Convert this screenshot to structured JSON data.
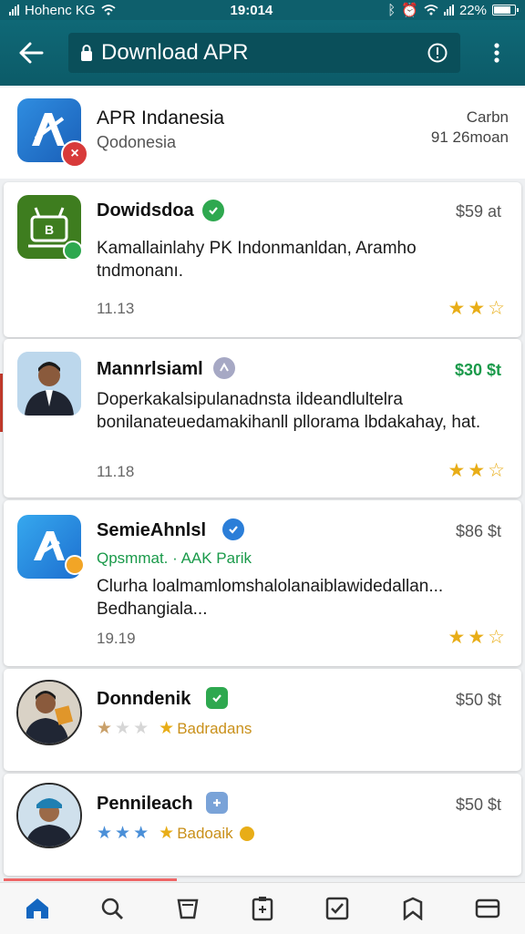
{
  "status_bar": {
    "carrier": "Hohenc KG",
    "time": "19:014",
    "battery": "22%"
  },
  "top_bar": {
    "search_value": "Download APR"
  },
  "header_app": {
    "title": "APR Indanesia",
    "subtitle": "Qodonesia",
    "right_line1": "Carbn",
    "right_line2": "91 26moan"
  },
  "apps": [
    {
      "title": "Dowidsdoa",
      "price": "$59 at",
      "description": "Kamallainlahy PK Indonmanldan, Aramho tndmonanı.",
      "meta": "11.13",
      "rating": 2
    },
    {
      "title": "Mannrlsiaml",
      "price": "$30 $t",
      "description": "Doperkakalsipulanadnsta ildeandlultelra bonilanateuedamakihanll pllorama lbdakahay, hat.",
      "meta": "11.18",
      "rating": 2
    },
    {
      "title": "SemieAhnlsl",
      "price": "$86 $t",
      "tagline": "Qpsmmat. · AAK Parik",
      "description": "Clurha loalmamlomshalolanaiblawidedallan... Bedhangiala...",
      "meta": "19.19",
      "rating": 2
    },
    {
      "title": "Donndenik",
      "price": "$50 $t",
      "stars_label": "Badradans",
      "rating": 1
    },
    {
      "title": "Pennileach",
      "price": "$50 $t",
      "stars_label": "Badoaik",
      "rating": 3
    }
  ],
  "colors": {
    "header": "#0f6876",
    "accent_green": "#1a9a4a",
    "star": "#e8ad17",
    "nav_active": "#1366c0"
  },
  "bottom_nav": [
    "home-icon",
    "search-icon",
    "cart-icon",
    "clipboard-icon",
    "checkbox-icon",
    "bookmark-icon",
    "wallet-icon"
  ]
}
